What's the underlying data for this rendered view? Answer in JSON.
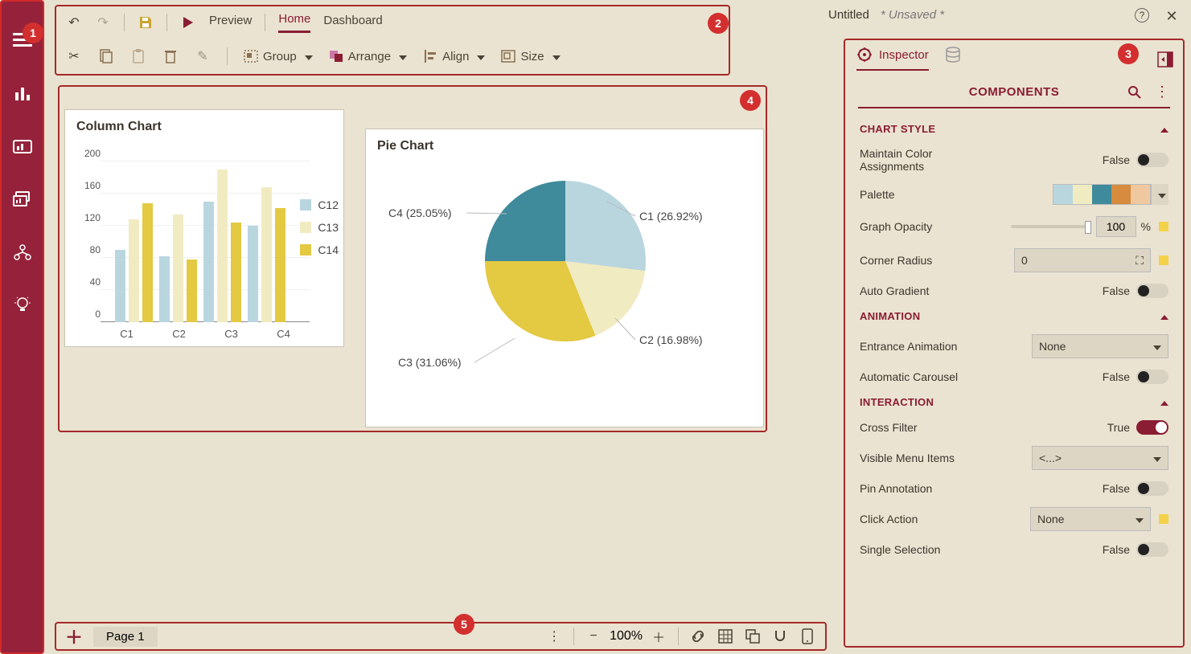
{
  "title": {
    "name": "Untitled",
    "status": "* Unsaved *"
  },
  "toolbar": {
    "tabs": {
      "preview": "Preview",
      "home": "Home",
      "dashboard": "Dashboard"
    },
    "buttons": {
      "group": "Group",
      "arrange": "Arrange",
      "align": "Align",
      "size": "Size"
    }
  },
  "inspector": {
    "tabs": {
      "inspector": "Inspector"
    },
    "header": "COMPONENTS",
    "sections": {
      "chart_style": {
        "title": "CHART STYLE",
        "maintain": {
          "label": "Maintain Color Assignments",
          "value": "False"
        },
        "palette": {
          "label": "Palette"
        },
        "opacity": {
          "label": "Graph Opacity",
          "value": "100",
          "unit": "%"
        },
        "radius": {
          "label": "Corner Radius",
          "value": "0"
        },
        "gradient": {
          "label": "Auto Gradient",
          "value": "False"
        }
      },
      "animation": {
        "title": "ANIMATION",
        "entrance": {
          "label": "Entrance Animation",
          "value": "None"
        },
        "carousel": {
          "label": "Automatic Carousel",
          "value": "False"
        }
      },
      "interaction": {
        "title": "INTERACTION",
        "cross": {
          "label": "Cross Filter",
          "value": "True"
        },
        "menu": {
          "label": "Visible Menu Items",
          "value": "<...>"
        },
        "pin": {
          "label": "Pin Annotation",
          "value": "False"
        },
        "click": {
          "label": "Click Action",
          "value": "None"
        },
        "single": {
          "label": "Single Selection",
          "value": "False"
        }
      }
    }
  },
  "palette_colors": [
    "#b9d6df",
    "#f1ebc2",
    "#3f8a9b",
    "#d68b3e",
    "#f0c8a0"
  ],
  "canvas": {
    "column_title": "Column Chart",
    "pie_title": "Pie Chart"
  },
  "bottombar": {
    "page": "Page 1",
    "zoom": "100%"
  },
  "badges": {
    "b1": "1",
    "b2": "2",
    "b3": "3",
    "b4": "4",
    "b5": "5"
  },
  "chart_data": [
    {
      "type": "bar",
      "title": "Column Chart",
      "categories": [
        "C1",
        "C2",
        "C3",
        "C4"
      ],
      "series": [
        {
          "name": "C12",
          "values": [
            90,
            82,
            150,
            120
          ],
          "color": "#b9d6df"
        },
        {
          "name": "C13",
          "values": [
            128,
            134,
            190,
            168
          ],
          "color": "#f1ebc2"
        },
        {
          "name": "C14",
          "values": [
            148,
            78,
            124,
            142
          ],
          "color": "#e4c942"
        }
      ],
      "ylim": [
        0,
        200
      ],
      "yticks": [
        0,
        40,
        80,
        120,
        160,
        200
      ],
      "xlabel": "",
      "ylabel": "",
      "legend": [
        "C12",
        "C13",
        "C14"
      ]
    },
    {
      "type": "pie",
      "title": "Pie Chart",
      "slices": [
        {
          "name": "C1",
          "percent": 26.92,
          "color": "#b9d6df"
        },
        {
          "name": "C2",
          "percent": 16.98,
          "color": "#f1ebc2"
        },
        {
          "name": "C3",
          "percent": 31.06,
          "color": "#e4c942"
        },
        {
          "name": "C4",
          "percent": 25.05,
          "color": "#3f8a9b"
        }
      ],
      "labels": {
        "c1": "C1 (26.92%)",
        "c2": "C2 (16.98%)",
        "c3": "C3 (31.06%)",
        "c4": "C4 (25.05%)"
      }
    }
  ]
}
